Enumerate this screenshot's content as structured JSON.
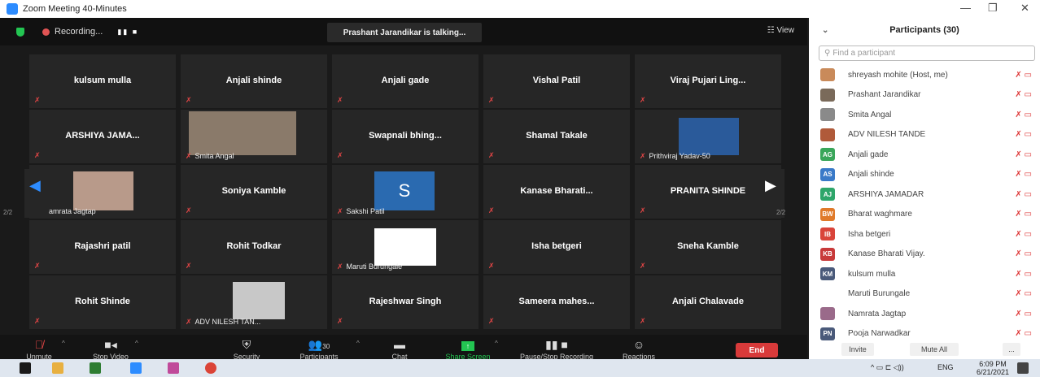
{
  "window": {
    "title": "Zoom Meeting 40-Minutes",
    "controls": [
      "—",
      "❐",
      "✕"
    ]
  },
  "topbar": {
    "recording_label": "Recording...",
    "talking": "Prashant Jarandikar is talking...",
    "view_label": "View"
  },
  "tiles": [
    {
      "name": "kulsum mulla"
    },
    {
      "name": "Anjali shinde"
    },
    {
      "name": "Anjali gade"
    },
    {
      "name": "Vishal Patil"
    },
    {
      "name": "Viraj Pujari Ling..."
    },
    {
      "name": "ARSHIYA JAMA..."
    },
    {
      "name": "",
      "label": "Smita Angal"
    },
    {
      "name": "Swapnali bhing..."
    },
    {
      "name": "Shamal Takale"
    },
    {
      "name": "",
      "label": "Prithviraj Yadav-50"
    },
    {
      "name": "",
      "label": "Namrata Jagtap"
    },
    {
      "name": "Soniya Kamble"
    },
    {
      "name": "",
      "label": "Sakshi Patil",
      "avatar": "S"
    },
    {
      "name": "Kanase Bharati..."
    },
    {
      "name": "PRANITA SHINDE"
    },
    {
      "name": "Rajashri patil"
    },
    {
      "name": "Rohit Todkar"
    },
    {
      "name": "",
      "label": "Maruti Burungale"
    },
    {
      "name": "Isha betgeri"
    },
    {
      "name": "Sneha Kamble"
    },
    {
      "name": "Rohit Shinde"
    },
    {
      "name": "",
      "label": "ADV NILESH TAN..."
    },
    {
      "name": "Rajeshwar Singh"
    },
    {
      "name": "Sameera mahes..."
    },
    {
      "name": "Anjali Chalavade"
    }
  ],
  "pager": {
    "left": "2/2",
    "right": "2/2"
  },
  "toolbar": {
    "unmute": "Unmute",
    "stop_video": "Stop Video",
    "security": "Security",
    "participants": "Participants",
    "participants_count": "30",
    "chat": "Chat",
    "share_screen": "Share Screen",
    "pause_recording": "Pause/Stop Recording",
    "reactions": "Reactions",
    "end": "End"
  },
  "panel": {
    "title": "Participants (30)",
    "search_placeholder": "Find a participant",
    "participants": [
      {
        "name": "shreyash mohite (Host, me)",
        "initials": "",
        "color": "#c98a5a"
      },
      {
        "name": "Prashant Jarandikar",
        "initials": "",
        "color": "#7a6a5a"
      },
      {
        "name": "Smita Angal",
        "initials": "",
        "color": "#8a8a8a"
      },
      {
        "name": "ADV NILESH TANDE",
        "initials": "",
        "color": "#b05a3a"
      },
      {
        "name": "Anjali gade",
        "initials": "AG",
        "color": "#3aa65a"
      },
      {
        "name": "Anjali shinde",
        "initials": "AS",
        "color": "#3a7ac8"
      },
      {
        "name": "ARSHIYA JAMADAR",
        "initials": "AJ",
        "color": "#2ea66a"
      },
      {
        "name": "Bharat waghmare",
        "initials": "BW",
        "color": "#e07a2a"
      },
      {
        "name": "Isha betgeri",
        "initials": "IB",
        "color": "#d9443a"
      },
      {
        "name": "Kanase Bharati Vijay.",
        "initials": "KB",
        "color": "#c83a3a"
      },
      {
        "name": "kulsum mulla",
        "initials": "KM",
        "color": "#4a5a7a"
      },
      {
        "name": "Maruti Burungale",
        "initials": "",
        "color": "#ffffff"
      },
      {
        "name": "Namrata Jagtap",
        "initials": "",
        "color": "#9a6a8a"
      },
      {
        "name": "Pooja Narwadkar",
        "initials": "PN",
        "color": "#4a5a7a"
      }
    ],
    "invite": "Invite",
    "mute_all": "Mute All",
    "more": "..."
  },
  "taskbar": {
    "lang": "ENG",
    "time": "6:09 PM",
    "date": "6/21/2021"
  }
}
